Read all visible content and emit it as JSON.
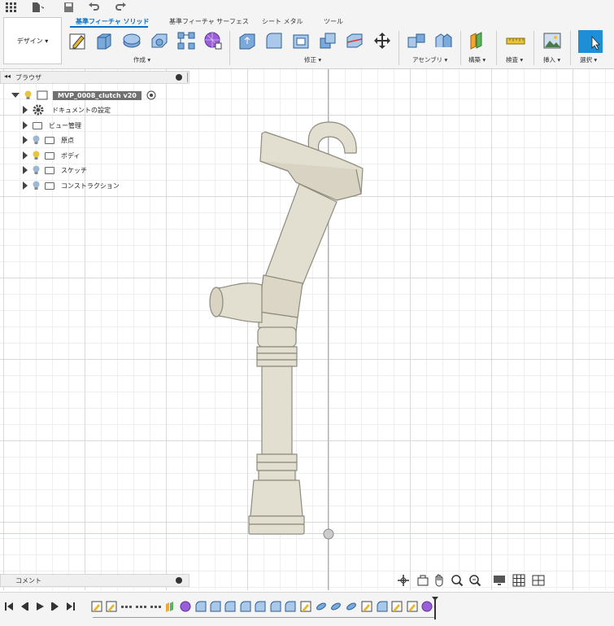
{
  "tabs": {
    "solid": "基準フィーチャ ソリッド",
    "surface": "基準フィーチャ サーフェス",
    "sheet_metal": "シート メタル",
    "tools": "ツール"
  },
  "workspace": {
    "label": "デザイン ▾"
  },
  "groups": {
    "create": "作成 ▾",
    "modify": "修正 ▾",
    "assemble": "アセンブリ ▾",
    "construct": "構築 ▾",
    "inspect": "検査 ▾",
    "insert": "挿入 ▾",
    "select": "選択 ▾"
  },
  "browser": {
    "title": "ブラウザ",
    "root": "MVP_0008_clutch v20",
    "items": [
      {
        "label": "ドキュメントの設定",
        "icon": "gear-icon"
      },
      {
        "label": "ビュー管理",
        "icon": "folder-icon"
      },
      {
        "label": "原点",
        "icon": "folder-icon"
      },
      {
        "label": "ボディ",
        "icon": "folder-icon"
      },
      {
        "label": "スケッチ",
        "icon": "folder-icon"
      },
      {
        "label": "コンストラクション",
        "icon": "folder-icon"
      }
    ]
  },
  "comments": {
    "title": "コメント"
  },
  "colors": {
    "accent": "#0a6fc2",
    "model": "#e3dfd0",
    "model_stroke": "#8e8a7c",
    "bulb_on": "#e8c53a",
    "bulb_off": "#9ab8d8"
  },
  "icons": {
    "nav": [
      "orbit-icon",
      "look-at-icon",
      "pan-icon",
      "zoom-icon",
      "fit-icon",
      "display-settings-icon",
      "grid-icon",
      "viewports-icon"
    ],
    "playback": [
      "first-icon",
      "prev-icon",
      "play-icon",
      "next-icon",
      "last-icon"
    ]
  }
}
